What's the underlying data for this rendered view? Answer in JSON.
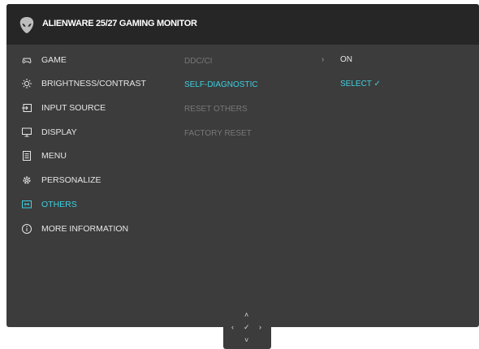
{
  "header": {
    "title": "ALIENWARE 25/27 GAMING MONITOR",
    "logo_icon": "alien-head-icon"
  },
  "menu": {
    "items": [
      {
        "label": "GAME",
        "icon": "gamepad-icon"
      },
      {
        "label": "BRIGHTNESS/CONTRAST",
        "icon": "sun-icon"
      },
      {
        "label": "INPUT SOURCE",
        "icon": "input-source-icon"
      },
      {
        "label": "DISPLAY",
        "icon": "monitor-icon"
      },
      {
        "label": "MENU",
        "icon": "menu-icon"
      },
      {
        "label": "PERSONALIZE",
        "icon": "gear-icon"
      },
      {
        "label": "OTHERS",
        "icon": "others-icon"
      },
      {
        "label": "MORE INFORMATION",
        "icon": "info-icon"
      }
    ],
    "selected": "OTHERS"
  },
  "submenu": {
    "items": [
      {
        "label": "DDC/CI"
      },
      {
        "label": "SELF-DIAGNOSTIC"
      },
      {
        "label": "RESET OTHERS"
      },
      {
        "label": "FACTORY RESET"
      }
    ],
    "selected": "SELF-DIAGNOSTIC"
  },
  "values": {
    "ddc_ci": "ON",
    "self_diagnostic": "SELECT ✓"
  },
  "joystick": {
    "up": "˄",
    "left": "‹",
    "center": "✓",
    "right": "›",
    "down": "˅"
  },
  "colors": {
    "accent": "#3dd0e0",
    "panel": "#3c3c3c",
    "titlebar": "#262626"
  }
}
